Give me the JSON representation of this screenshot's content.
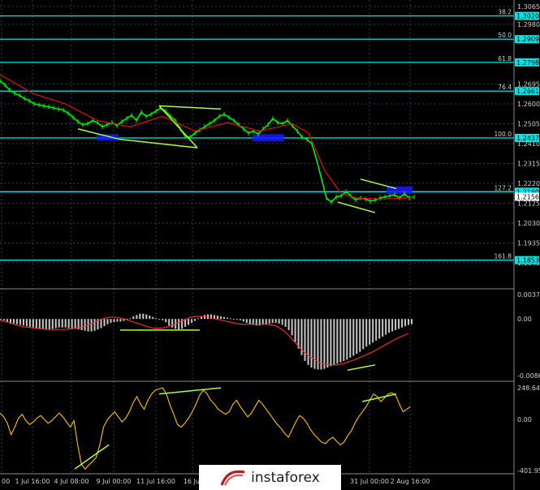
{
  "colors": {
    "background": "#000000",
    "grid": "#2f3f4f",
    "fibo": "#00e5e5",
    "candle": "#00ee00",
    "ma": "#e01010",
    "trend": "#adff2f",
    "zone": "#1a1aff",
    "hist": "#c8c8c8",
    "signal": "#ff3030",
    "osc": "#ffc000",
    "axis_text": "#cfcfcf"
  },
  "watermark": {
    "text": "instaforex",
    "icon": "instaforex-logo-icon"
  },
  "chart_data": [
    {
      "type": "line",
      "panel": "price",
      "yaxis_ticks": [
        "1.3065",
        "1.2980",
        "1.2695",
        "1.2600",
        "1.2505",
        "1.2410",
        "1.2315",
        "1.2220",
        "1.2125",
        "1.2030",
        "1.1935",
        "1.1840"
      ],
      "ylim": [
        1.184,
        1.3065
      ],
      "fibo_levels": [
        {
          "label": "38.2",
          "value": 1.302,
          "badge": "1.3020"
        },
        {
          "label": "50.0",
          "value": 1.2909,
          "badge": "1.2909"
        },
        {
          "label": "61.8",
          "value": 1.2798,
          "badge": "1.2798"
        },
        {
          "label": "76.4",
          "value": 1.2661,
          "badge": "1.2661"
        },
        {
          "label": "100.0",
          "value": 1.2437,
          "badge": "1.2437"
        },
        {
          "label": "127.2",
          "value": 1.218,
          "badge": "1.2180"
        },
        {
          "label": "161.8",
          "value": 1.1853,
          "badge": "1.1853"
        }
      ],
      "current_price": {
        "value": 1.2156,
        "badge": "1.2156"
      },
      "series": [
        {
          "x": [
            0,
            6,
            12,
            18,
            24,
            30,
            36,
            42,
            48,
            54,
            60,
            66,
            72,
            78,
            84,
            90,
            96,
            102,
            108,
            114,
            120,
            126,
            132,
            138,
            144,
            150,
            156,
            162,
            168,
            174,
            180,
            186,
            192,
            198,
            204,
            210,
            216,
            222,
            228,
            234,
            240,
            246,
            252,
            258,
            264,
            270,
            276,
            282,
            288,
            294,
            300,
            306,
            312,
            318,
            324,
            330,
            336,
            342,
            348,
            354,
            360,
            366,
            372,
            378,
            384,
            390,
            396,
            402,
            408,
            414,
            420,
            426,
            432,
            438,
            444,
            450,
            456,
            462,
            468,
            474,
            480,
            486,
            492,
            498,
            504,
            510
          ],
          "values": [
            1.271,
            1.269,
            1.2665,
            1.265,
            1.264,
            1.2625,
            1.2615,
            1.26,
            1.2595,
            1.259,
            1.2585,
            1.258,
            1.2575,
            1.257,
            1.2555,
            1.2535,
            1.2515,
            1.25,
            1.2505,
            1.252,
            1.251,
            1.249,
            1.25,
            1.251,
            1.2495,
            1.2515,
            1.253,
            1.2545,
            1.252,
            1.256,
            1.254,
            1.255,
            1.2565,
            1.258,
            1.2565,
            1.254,
            1.252,
            1.248,
            1.2445,
            1.244,
            1.246,
            1.2475,
            1.249,
            1.2505,
            1.252,
            1.254,
            1.255,
            1.2535,
            1.252,
            1.25,
            1.248,
            1.246,
            1.247,
            1.2455,
            1.248,
            1.25,
            1.253,
            1.251,
            1.2505,
            1.252,
            1.2495,
            1.247,
            1.244,
            1.243,
            1.241,
            1.233,
            1.224,
            1.215,
            1.213,
            1.2155,
            1.216,
            1.218,
            1.216,
            1.214,
            1.215,
            1.2145,
            1.2135,
            1.214,
            1.215,
            1.2155,
            1.216,
            1.2165,
            1.215,
            1.217,
            1.215,
            1.2155
          ]
        },
        {
          "name": "",
          "x": [
            0,
            40,
            80,
            120,
            160,
            200,
            240,
            280,
            320,
            360,
            380,
            400,
            420,
            440,
            470,
            500,
            510
          ],
          "values": [
            1.274,
            1.265,
            1.26,
            1.252,
            1.249,
            1.254,
            1.247,
            1.251,
            1.247,
            1.2505,
            1.246,
            1.228,
            1.217,
            1.215,
            1.2145,
            1.215,
            1.2152
          ]
        }
      ],
      "trend_lines": [
        {
          "x": [
            96,
            148
          ],
          "values": [
            1.248,
            1.243
          ]
        },
        {
          "x": [
            148,
            243
          ],
          "values": [
            1.243,
            1.239
          ]
        },
        {
          "x": [
            196,
            272
          ],
          "values": [
            1.259,
            1.2575
          ]
        },
        {
          "x": [
            196,
            243
          ],
          "values": [
            1.259,
            1.239
          ]
        },
        {
          "x": [
            416,
            462
          ],
          "values": [
            1.213,
            1.208
          ]
        },
        {
          "x": [
            444,
            488
          ],
          "values": [
            1.224,
            1.2195
          ]
        }
      ],
      "zones": [
        {
          "x": [
            119,
            146
          ],
          "values": [
            1.2455,
            1.2425
          ]
        },
        {
          "x": [
            311,
            350
          ],
          "values": [
            1.2455,
            1.242
          ]
        },
        {
          "x": [
            476,
            508
          ],
          "values": [
            1.2205,
            1.217
          ]
        }
      ],
      "x_ticks": [
        {
          "x": 2,
          "label": "00"
        },
        {
          "x": 40,
          "label": "1 Jul 16:00"
        },
        {
          "x": 88,
          "label": "4 Jul 08:00"
        },
        {
          "x": 140,
          "label": "9 Jul 00:00"
        },
        {
          "x": 192,
          "label": "11 Jul 16:00"
        },
        {
          "x": 237,
          "label": "16 Jul"
        },
        {
          "x": 455,
          "label": "31 Jul 00:00"
        },
        {
          "x": 505,
          "label": "2 Aug 16:00"
        }
      ]
    },
    {
      "type": "bar",
      "panel": "macd",
      "yaxis_ticks": [
        "0.00373",
        "0.00",
        "-0.00863"
      ],
      "ylim": [
        -0.00863,
        0.00373
      ],
      "values": [
        -0.0001,
        -0.0002,
        -0.0004,
        -0.0006,
        -0.0007,
        -0.0008,
        -0.0009,
        -0.001,
        -0.0011,
        -0.0012,
        -0.0013,
        -0.0014,
        -0.0014,
        -0.0015,
        -0.0016,
        -0.0016,
        -0.0015,
        -0.0014,
        -0.0013,
        -0.0013,
        -0.0013,
        -0.0014,
        -0.0015,
        -0.0015,
        -0.0016,
        -0.0017,
        -0.0018,
        -0.0019,
        -0.0019,
        -0.0018,
        -0.0016,
        -0.0014,
        -0.0011,
        -0.0008,
        -0.0006,
        -0.0005,
        -0.0004,
        -0.0004,
        -0.0003,
        -0.0001,
        0.0001,
        0.0004,
        0.0006,
        0.0008,
        0.0008,
        0.0007,
        0.0005,
        0.0003,
        0.0001,
        -0.0001,
        -0.0002,
        -0.0005,
        -0.001,
        -0.0013,
        -0.0015,
        -0.0016,
        -0.0015,
        -0.0012,
        -0.0009,
        -0.0006,
        -0.0003,
        0.0001,
        0.0004,
        0.0006,
        0.0007,
        0.0007,
        0.0006,
        0.0005,
        0.0004,
        0.0003,
        0.0002,
        0.0001,
        0.0,
        -0.0001,
        -0.0002,
        -0.0004,
        -0.0006,
        -0.0008,
        -0.0009,
        -0.001,
        -0.001,
        -0.0009,
        -0.0008,
        -0.0007,
        -0.0006,
        -0.0006,
        -0.0007,
        -0.0009,
        -0.0012,
        -0.0017,
        -0.0025,
        -0.0035,
        -0.0045,
        -0.0055,
        -0.0064,
        -0.007,
        -0.0074,
        -0.0076,
        -0.0077,
        -0.0077,
        -0.0076,
        -0.0074,
        -0.0072,
        -0.007,
        -0.0068,
        -0.0066,
        -0.0064,
        -0.0062,
        -0.0059,
        -0.0056,
        -0.0053,
        -0.005,
        -0.0046,
        -0.0042,
        -0.0039,
        -0.0036,
        -0.0033,
        -0.003,
        -0.0027,
        -0.0024,
        -0.0021,
        -0.0019,
        -0.0017,
        -0.0015,
        -0.0013,
        -0.0011,
        -0.0009,
        -0.0008
      ],
      "signal": [
        -0.0002,
        -0.0004,
        -0.0007,
        -0.001,
        -0.0012,
        -0.0013,
        -0.0014,
        -0.0015,
        -0.0016,
        -0.0016,
        -0.0016,
        -0.0016,
        -0.0015,
        -0.0014,
        -0.0012,
        -0.0009,
        -0.0005,
        -0.0001,
        0.0002,
        0.0003,
        0.0002,
        0.0,
        -0.0003,
        -0.0006,
        -0.0009,
        -0.0012,
        -0.0014,
        -0.0014,
        -0.0013,
        -0.001,
        -0.0006,
        -0.0002,
        0.0002,
        0.0004,
        0.0004,
        0.0003,
        0.0001,
        -0.0001,
        -0.0003,
        -0.0005,
        -0.0007,
        -0.0008,
        -0.0008,
        -0.0008,
        -0.0008,
        -0.0008,
        -0.0009,
        -0.0012,
        -0.0018,
        -0.0027,
        -0.0037,
        -0.0047,
        -0.0055,
        -0.0061,
        -0.0066,
        -0.0069,
        -0.007,
        -0.007,
        -0.0068,
        -0.0065,
        -0.0062,
        -0.0058,
        -0.0054,
        -0.005,
        -0.0045,
        -0.004,
        -0.0035,
        -0.003,
        -0.0026,
        -0.0022
      ],
      "trend_lines": [
        {
          "x": [
            148,
            246
          ],
          "values": [
            -0.0017,
            -0.0017
          ]
        },
        {
          "x": [
            428,
            462
          ],
          "values": [
            -0.0078,
            -0.007
          ]
        }
      ]
    },
    {
      "type": "line",
      "panel": "oscillator",
      "yaxis_ticks": [
        "248.6406",
        "0.00",
        "-401.958"
      ],
      "ylim": [
        -401.958,
        248.6406
      ],
      "values": [
        50,
        20,
        -30,
        -120,
        -60,
        10,
        40,
        -10,
        -40,
        -20,
        10,
        30,
        0,
        -30,
        -10,
        20,
        50,
        20,
        -20,
        -60,
        -10,
        -200,
        -350,
        -390,
        -360,
        -330,
        -300,
        -200,
        -60,
        -5,
        30,
        60,
        20,
        -20,
        10,
        60,
        130,
        180,
        120,
        80,
        150,
        200,
        230,
        240,
        248,
        200,
        110,
        40,
        -40,
        -60,
        -30,
        10,
        60,
        120,
        190,
        230,
        200,
        150,
        120,
        80,
        60,
        40,
        60,
        120,
        150,
        100,
        60,
        20,
        50,
        100,
        150,
        120,
        80,
        40,
        0,
        -40,
        -70,
        -110,
        -140,
        -80,
        -20,
        30,
        10,
        -30,
        -80,
        -120,
        -150,
        -180,
        -190,
        -160,
        -140,
        -170,
        -200,
        -180,
        -130,
        -90,
        -30,
        20,
        60,
        100,
        150,
        200,
        180,
        140,
        170,
        200,
        210,
        190,
        120,
        60,
        80,
        100
      ],
      "trend_lines": [
        {
          "x": [
            92,
            134
          ],
          "values": [
            -390,
            -200
          ]
        },
        {
          "x": [
            196,
            272
          ],
          "values": [
            200,
            248
          ]
        },
        {
          "x": [
            446,
            488
          ],
          "values": [
            140,
            200
          ]
        }
      ]
    }
  ]
}
